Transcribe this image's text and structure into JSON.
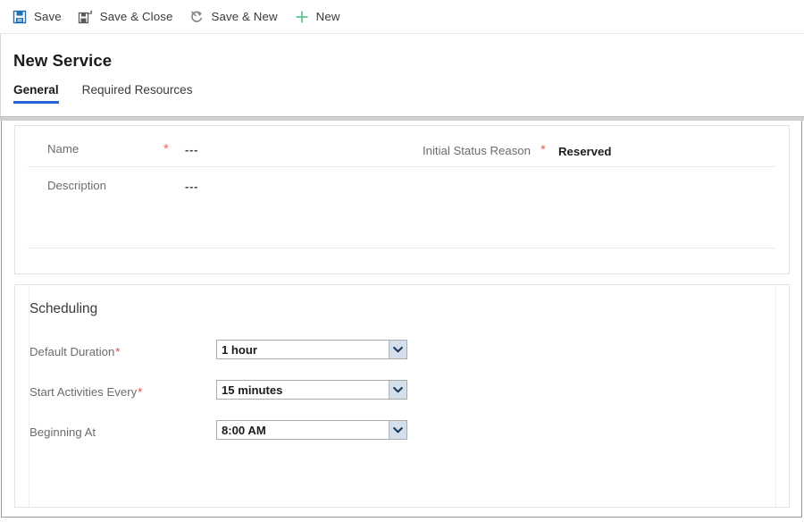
{
  "command_bar": {
    "buttons": [
      {
        "label": "Save",
        "icon": "save-disk-icon",
        "icon_color": "#1f6fb5"
      },
      {
        "label": "Save & Close",
        "icon": "save-and-close-icon",
        "icon_color": "#5b5b5b"
      },
      {
        "label": "Save & New",
        "icon": "save-and-new-icon",
        "icon_color": "#8a8a8a"
      },
      {
        "label": "New",
        "icon": "plus-icon",
        "icon_color": "#5fc98f"
      }
    ]
  },
  "header": {
    "title": "New Service"
  },
  "tabs": [
    {
      "label": "General",
      "active": true
    },
    {
      "label": "Required Resources",
      "active": false
    }
  ],
  "general_section": {
    "fields": [
      {
        "label": "Name",
        "required": true,
        "value": "---",
        "value_state": "empty"
      },
      {
        "label": "Description",
        "required": false,
        "value": "---",
        "value_state": "empty"
      },
      {
        "label": "Initial Status Reason",
        "required": true,
        "value": "Reserved",
        "value_state": "filled"
      }
    ]
  },
  "scheduling_section": {
    "title": "Scheduling",
    "fields": [
      {
        "label": "Default Duration",
        "required": true,
        "value": "1 hour",
        "control": "dropdown"
      },
      {
        "label": "Start Activities Every",
        "required": true,
        "value": "15 minutes",
        "control": "dropdown"
      },
      {
        "label": "Beginning At",
        "required": false,
        "value": "8:00 AM",
        "control": "dropdown"
      }
    ]
  },
  "symbols": {
    "required_marker": "*"
  },
  "colors": {
    "accent_tab": "#2266d3",
    "required_star": "#e8413c",
    "required_star_muted": "#e8685a",
    "new_icon_green": "#5fc98f",
    "save_icon_blue": "#1f6fb5",
    "dropdown_button": "#d4dfeb"
  }
}
